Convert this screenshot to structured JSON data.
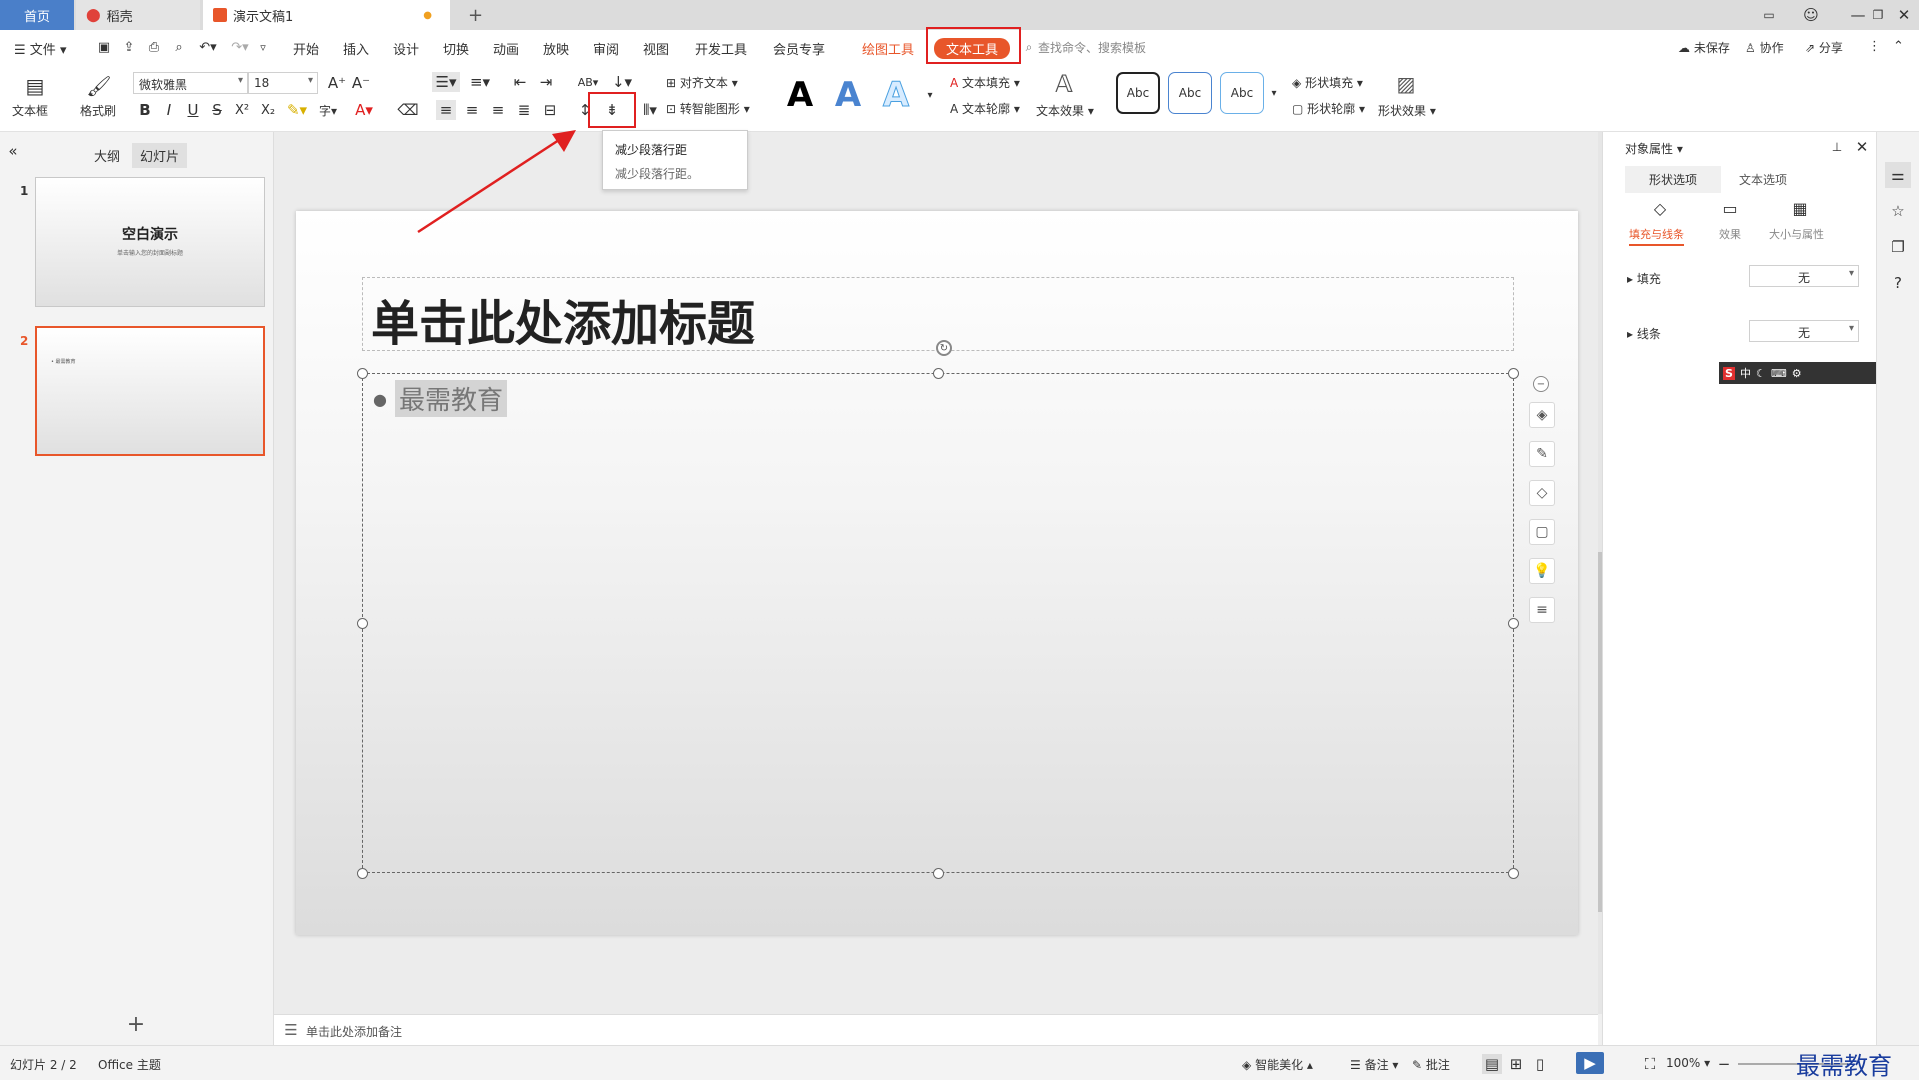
{
  "tabs": {
    "home": "首页",
    "daoke": "稻壳",
    "doc": "演示文稿1",
    "new_tab": "+"
  },
  "menu": {
    "file": "文件",
    "items": [
      "开始",
      "插入",
      "设计",
      "切换",
      "动画",
      "放映",
      "审阅",
      "视图",
      "开发工具",
      "会员专享"
    ],
    "draw_tools": "绘图工具",
    "text_tools": "文本工具",
    "search_placeholder": "查找命令、搜索模板",
    "unsaved": "未保存",
    "collab": "协作",
    "share": "分享"
  },
  "ribbon": {
    "textbox": "文本框",
    "format_painter": "格式刷",
    "font_name": "微软雅黑",
    "font_size": "18",
    "align_text": "对齐文本",
    "smartart": "转智能图形",
    "text_fill": "文本填充",
    "text_outline": "文本轮廓",
    "text_effect": "文本效果",
    "shape_fill": "形状填充",
    "shape_outline": "形状轮廓",
    "shape_effect": "形状效果",
    "abc": "Abc",
    "letter_a": "A",
    "bold": "B",
    "italic": "I",
    "underline": "U",
    "strike": "S"
  },
  "tooltip": {
    "title": "减少段落行距",
    "desc": "减少段落行距。"
  },
  "left_panel": {
    "outline_tab": "大纲",
    "slides_tab": "幻灯片",
    "slide1_num": "1",
    "slide1_title": "空白演示",
    "slide1_subtitle": "单击输入您的封面副标题",
    "slide2_num": "2",
    "slide2_bullet": "• 最需教育",
    "add": "+"
  },
  "slide": {
    "title": "单击此处添加标题",
    "bullet": "最需教育"
  },
  "notes": {
    "placeholder": "单击此处添加备注"
  },
  "right_panel": {
    "title": "对象属性",
    "tab_shape": "形状选项",
    "tab_text": "文本选项",
    "sub_fill_line": "填充与线条",
    "sub_effect": "效果",
    "sub_size": "大小与属性",
    "fill_label": "填充",
    "fill_value": "无",
    "line_label": "线条",
    "line_value": "无",
    "ime_cn": "中",
    "ime_logo": "S"
  },
  "status": {
    "slide_info": "幻灯片 2 / 2",
    "theme": "Office 主题",
    "beautify": "智能美化",
    "notes": "备注",
    "comments": "批注",
    "zoom": "100%",
    "watermark": "最需教育"
  },
  "colors": {
    "accent": "#e8562a",
    "highlight_box": "#e02020",
    "tab_home": "#4a7fc9",
    "text_tools_bg": "#e8562a"
  }
}
